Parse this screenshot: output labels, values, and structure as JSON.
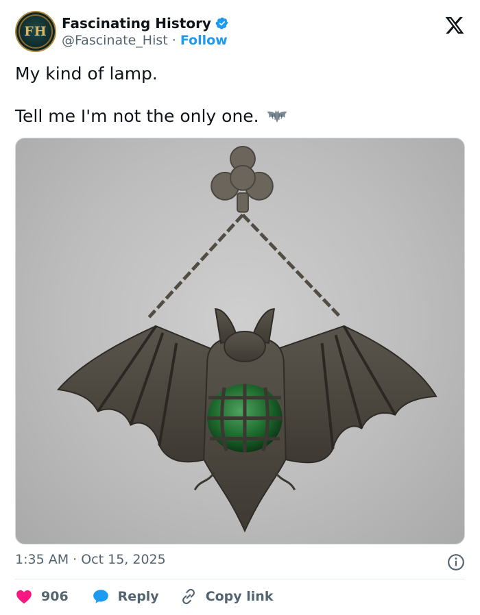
{
  "account": {
    "avatar_text": "FH",
    "name": "Fascinating History",
    "handle": "@Fascinate_Hist",
    "separator": "·",
    "follow_label": "Follow"
  },
  "post": {
    "line1": "My kind of lamp.",
    "line2": "Tell me I'm not the only one.",
    "emoji": "bat-emoji",
    "media_description_icon": "bat-lamp-image"
  },
  "meta": {
    "timestamp": "1:35 AM · Oct 15, 2025"
  },
  "actions": {
    "likes": "906",
    "reply_label": "Reply",
    "copy_label": "Copy link"
  },
  "colors": {
    "accent": "#1d9bf0",
    "like": "#f91880",
    "text": "#0f1419",
    "secondary": "#536471"
  }
}
